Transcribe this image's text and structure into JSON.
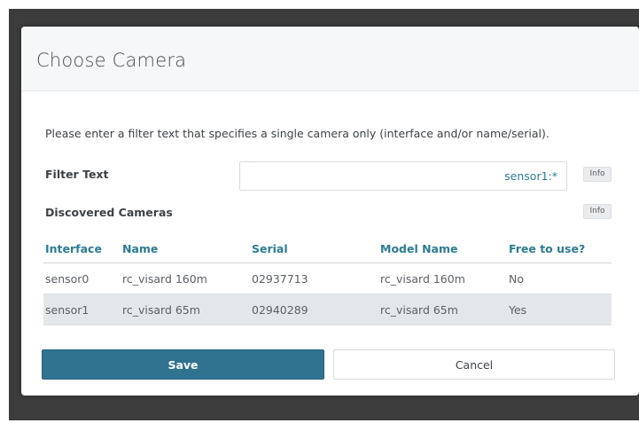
{
  "dialog": {
    "title": "Choose Camera",
    "instruction": "Please enter a filter text that specifies a single camera only (interface and/or name/serial).",
    "filter": {
      "label": "Filter Text",
      "value": "sensor1:*",
      "info_label": "Info"
    },
    "discovered": {
      "label": "Discovered Cameras",
      "info_label": "Info"
    },
    "table": {
      "columns": [
        "Interface",
        "Name",
        "Serial",
        "Model Name",
        "Free to use?"
      ],
      "rows": [
        [
          "sensor0",
          "rc_visard 160m",
          "02937713",
          "rc_visard 160m",
          "No"
        ],
        [
          "sensor1",
          "rc_visard 65m",
          "02940289",
          "rc_visard 65m",
          "Yes"
        ]
      ],
      "selected_row": 1
    },
    "buttons": {
      "save_label": "Save",
      "cancel_label": "Cancel"
    }
  },
  "colors": {
    "accent": "#2b7c94",
    "primary_button": "#2f7391",
    "selected_row": "#e4e7ea",
    "backdrop": "#3c3c3c"
  }
}
